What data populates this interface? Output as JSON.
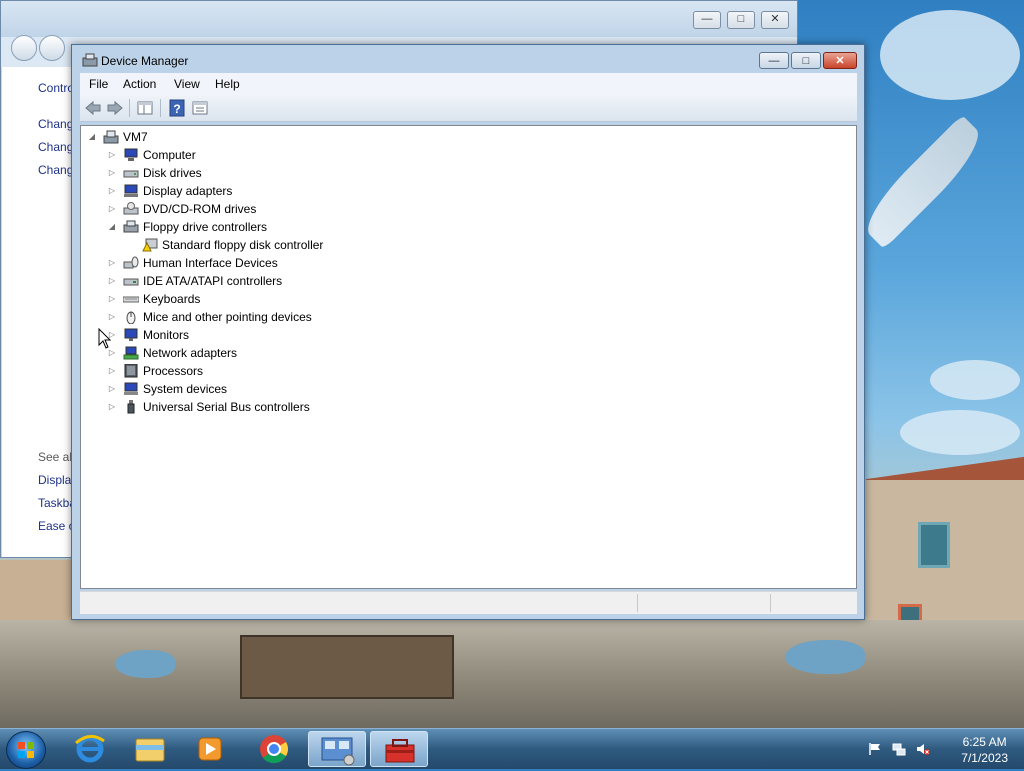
{
  "background_window": {
    "minimize": "—",
    "maximize": "□",
    "close": "✕",
    "left_links": [
      "Contro",
      "Chang",
      "Chang",
      "Chang"
    ],
    "see_also_label": "See als",
    "see_also_links": [
      "Display",
      "Taskba",
      "Ease o"
    ]
  },
  "device_manager": {
    "title": "Device Manager",
    "title_buttons": {
      "minimize": "—",
      "maximize": "□",
      "close": "✕"
    },
    "menu": [
      "File",
      "Action",
      "View",
      "Help"
    ],
    "toolbar_icons": [
      "back-arrow-icon",
      "forward-arrow-icon",
      "properties-pane-icon",
      "help-icon",
      "console-tree-icon"
    ],
    "tree": {
      "root": "VM7",
      "categories": [
        {
          "label": "Computer",
          "expanded": false,
          "icon": "computer-icon"
        },
        {
          "label": "Disk drives",
          "expanded": false,
          "icon": "disk-drive-icon"
        },
        {
          "label": "Display adapters",
          "expanded": false,
          "icon": "display-adapter-icon"
        },
        {
          "label": "DVD/CD-ROM drives",
          "expanded": false,
          "icon": "dvd-drive-icon"
        },
        {
          "label": "Floppy drive controllers",
          "expanded": true,
          "icon": "floppy-controller-icon",
          "children": [
            {
              "label": "Standard floppy disk controller",
              "icon": "warning-device-icon"
            }
          ]
        },
        {
          "label": "Human Interface Devices",
          "expanded": false,
          "icon": "hid-icon"
        },
        {
          "label": "IDE ATA/ATAPI controllers",
          "expanded": false,
          "icon": "ide-controller-icon"
        },
        {
          "label": "Keyboards",
          "expanded": false,
          "icon": "keyboard-icon"
        },
        {
          "label": "Mice and other pointing devices",
          "expanded": false,
          "icon": "mouse-icon"
        },
        {
          "label": "Monitors",
          "expanded": false,
          "icon": "monitor-icon"
        },
        {
          "label": "Network adapters",
          "expanded": false,
          "icon": "network-adapter-icon"
        },
        {
          "label": "Processors",
          "expanded": false,
          "icon": "processor-icon"
        },
        {
          "label": "System devices",
          "expanded": false,
          "icon": "system-devices-icon"
        },
        {
          "label": "Universal Serial Bus controllers",
          "expanded": false,
          "icon": "usb-icon"
        }
      ]
    }
  },
  "taskbar": {
    "apps": [
      "internet-explorer-icon",
      "windows-explorer-icon",
      "media-player-icon",
      "chrome-icon",
      "control-panel-icon",
      "toolbox-icon"
    ],
    "active_apps": [
      "control-panel-icon",
      "toolbox-icon"
    ],
    "tray_icons": [
      "action-center-flag-icon",
      "network-icon",
      "volume-muted-icon"
    ],
    "time": "6:25 AM",
    "date": "7/1/2023"
  },
  "colors": {
    "link_blue": "#1e3287",
    "taskbar_top": "#5f8fb6",
    "close_red": "#c8442b",
    "window_frame": "#bcd2e8"
  }
}
